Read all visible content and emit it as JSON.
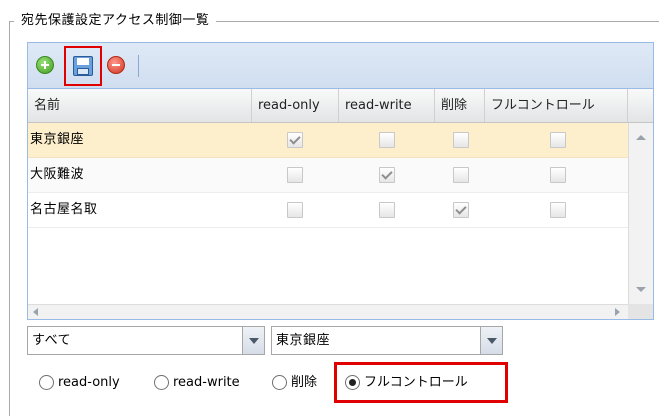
{
  "panel": {
    "title": "宛先保護設定アクセス制御一覧"
  },
  "toolbar": {
    "add_icon": "add-circle-icon",
    "save_icon": "save-disk-icon",
    "remove_icon": "remove-circle-icon",
    "colors": {
      "add": "#3f9a1f",
      "save": "#6aa0de",
      "remove": "#d0321e",
      "highlight": "#e00000"
    }
  },
  "grid": {
    "columns": [
      "名前",
      "read-only",
      "read-write",
      "削除",
      "フルコントロール"
    ],
    "rows": [
      {
        "name": "東京銀座",
        "read_only": true,
        "read_write": false,
        "delete": false,
        "full_control": false,
        "selected": true
      },
      {
        "name": "大阪難波",
        "read_only": false,
        "read_write": true,
        "delete": false,
        "full_control": false,
        "selected": false
      },
      {
        "name": "名古屋名取",
        "read_only": false,
        "read_write": false,
        "delete": true,
        "full_control": false,
        "selected": false
      }
    ]
  },
  "filters": {
    "scope_value": "すべて",
    "location_value": "東京銀座"
  },
  "permission_radio": {
    "options": [
      "read-only",
      "read-write",
      "削除",
      "フルコントロール"
    ],
    "selected": "フルコントロール"
  }
}
